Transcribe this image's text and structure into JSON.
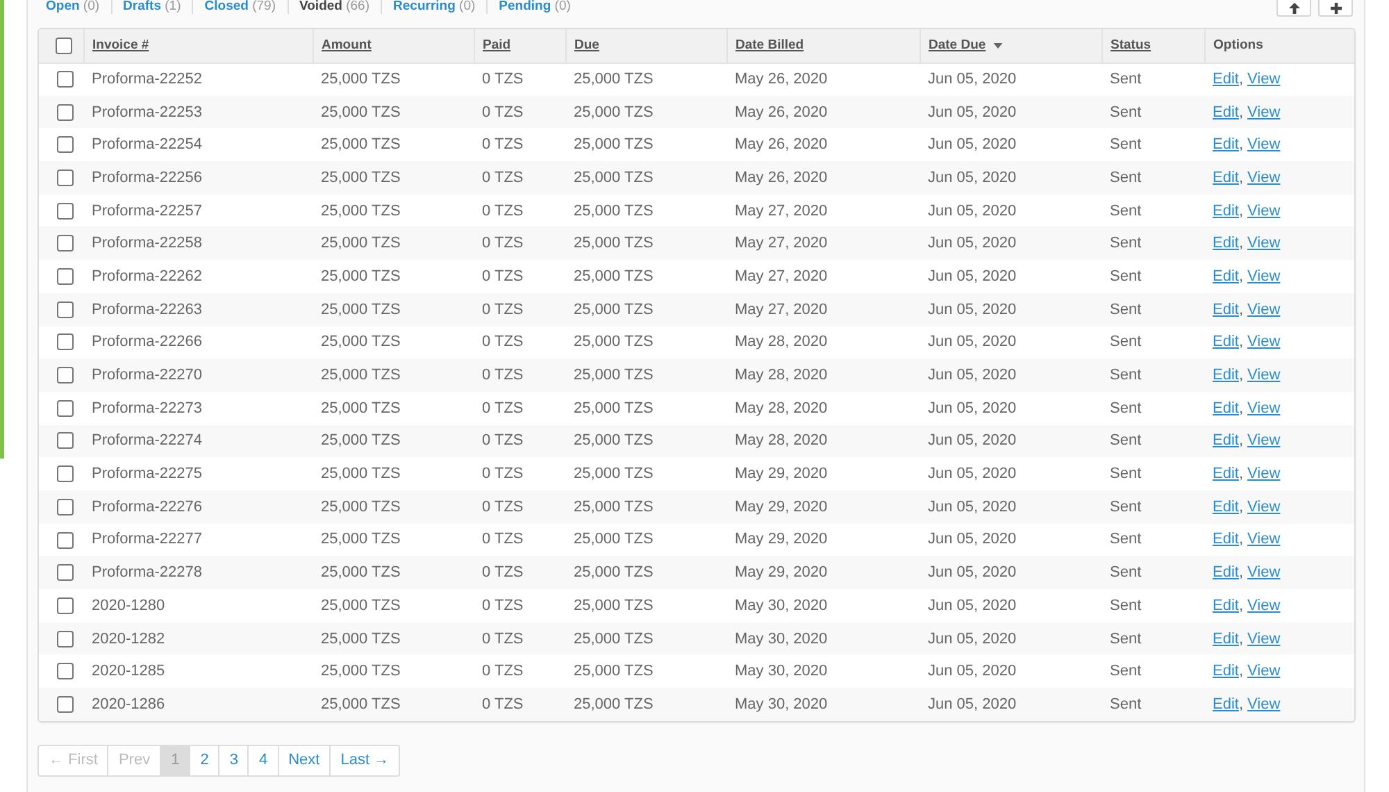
{
  "filters": [
    {
      "label": "Open",
      "count": "(0)",
      "selected": false
    },
    {
      "label": "Drafts",
      "count": "(1)",
      "selected": false
    },
    {
      "label": "Closed",
      "count": "(79)",
      "selected": false
    },
    {
      "label": "Voided",
      "count": "(66)",
      "selected": true
    },
    {
      "label": "Recurring",
      "count": "(0)",
      "selected": false
    },
    {
      "label": "Pending",
      "count": "(0)",
      "selected": false
    }
  ],
  "table": {
    "select_all": {
      "checked": false
    },
    "columns": [
      {
        "label": "Invoice #",
        "sortable": true,
        "sorted": false
      },
      {
        "label": "Amount",
        "sortable": true,
        "sorted": false
      },
      {
        "label": "Paid",
        "sortable": true,
        "sorted": false
      },
      {
        "label": "Due",
        "sortable": true,
        "sorted": false
      },
      {
        "label": "Date Billed",
        "sortable": true,
        "sorted": false
      },
      {
        "label": "Date Due",
        "sortable": true,
        "sorted": true
      },
      {
        "label": "Status",
        "sortable": true,
        "sorted": false
      },
      {
        "label": "Options",
        "sortable": false,
        "sorted": false
      }
    ],
    "options_separator": ",",
    "rows": [
      {
        "checked": false,
        "cells": [
          "Proforma-22252",
          "25,000 TZS",
          "0 TZS",
          "25,000 TZS",
          "May 26, 2020",
          "Jun 05, 2020",
          "Sent"
        ],
        "options": [
          "Edit",
          "View"
        ]
      },
      {
        "checked": false,
        "cells": [
          "Proforma-22253",
          "25,000 TZS",
          "0 TZS",
          "25,000 TZS",
          "May 26, 2020",
          "Jun 05, 2020",
          "Sent"
        ],
        "options": [
          "Edit",
          "View"
        ]
      },
      {
        "checked": false,
        "cells": [
          "Proforma-22254",
          "25,000 TZS",
          "0 TZS",
          "25,000 TZS",
          "May 26, 2020",
          "Jun 05, 2020",
          "Sent"
        ],
        "options": [
          "Edit",
          "View"
        ]
      },
      {
        "checked": false,
        "cells": [
          "Proforma-22256",
          "25,000 TZS",
          "0 TZS",
          "25,000 TZS",
          "May 26, 2020",
          "Jun 05, 2020",
          "Sent"
        ],
        "options": [
          "Edit",
          "View"
        ]
      },
      {
        "checked": false,
        "cells": [
          "Proforma-22257",
          "25,000 TZS",
          "0 TZS",
          "25,000 TZS",
          "May 27, 2020",
          "Jun 05, 2020",
          "Sent"
        ],
        "options": [
          "Edit",
          "View"
        ]
      },
      {
        "checked": false,
        "cells": [
          "Proforma-22258",
          "25,000 TZS",
          "0 TZS",
          "25,000 TZS",
          "May 27, 2020",
          "Jun 05, 2020",
          "Sent"
        ],
        "options": [
          "Edit",
          "View"
        ]
      },
      {
        "checked": false,
        "cells": [
          "Proforma-22262",
          "25,000 TZS",
          "0 TZS",
          "25,000 TZS",
          "May 27, 2020",
          "Jun 05, 2020",
          "Sent"
        ],
        "options": [
          "Edit",
          "View"
        ]
      },
      {
        "checked": false,
        "cells": [
          "Proforma-22263",
          "25,000 TZS",
          "0 TZS",
          "25,000 TZS",
          "May 27, 2020",
          "Jun 05, 2020",
          "Sent"
        ],
        "options": [
          "Edit",
          "View"
        ]
      },
      {
        "checked": false,
        "cells": [
          "Proforma-22266",
          "25,000 TZS",
          "0 TZS",
          "25,000 TZS",
          "May 28, 2020",
          "Jun 05, 2020",
          "Sent"
        ],
        "options": [
          "Edit",
          "View"
        ]
      },
      {
        "checked": false,
        "cells": [
          "Proforma-22270",
          "25,000 TZS",
          "0 TZS",
          "25,000 TZS",
          "May 28, 2020",
          "Jun 05, 2020",
          "Sent"
        ],
        "options": [
          "Edit",
          "View"
        ]
      },
      {
        "checked": false,
        "cells": [
          "Proforma-22273",
          "25,000 TZS",
          "0 TZS",
          "25,000 TZS",
          "May 28, 2020",
          "Jun 05, 2020",
          "Sent"
        ],
        "options": [
          "Edit",
          "View"
        ]
      },
      {
        "checked": false,
        "cells": [
          "Proforma-22274",
          "25,000 TZS",
          "0 TZS",
          "25,000 TZS",
          "May 28, 2020",
          "Jun 05, 2020",
          "Sent"
        ],
        "options": [
          "Edit",
          "View"
        ]
      },
      {
        "checked": false,
        "cells": [
          "Proforma-22275",
          "25,000 TZS",
          "0 TZS",
          "25,000 TZS",
          "May 29, 2020",
          "Jun 05, 2020",
          "Sent"
        ],
        "options": [
          "Edit",
          "View"
        ]
      },
      {
        "checked": false,
        "cells": [
          "Proforma-22276",
          "25,000 TZS",
          "0 TZS",
          "25,000 TZS",
          "May 29, 2020",
          "Jun 05, 2020",
          "Sent"
        ],
        "options": [
          "Edit",
          "View"
        ]
      },
      {
        "checked": false,
        "cells": [
          "Proforma-22277",
          "25,000 TZS",
          "0 TZS",
          "25,000 TZS",
          "May 29, 2020",
          "Jun 05, 2020",
          "Sent"
        ],
        "options": [
          "Edit",
          "View"
        ]
      },
      {
        "checked": false,
        "cells": [
          "Proforma-22278",
          "25,000 TZS",
          "0 TZS",
          "25,000 TZS",
          "May 29, 2020",
          "Jun 05, 2020",
          "Sent"
        ],
        "options": [
          "Edit",
          "View"
        ]
      },
      {
        "checked": false,
        "cells": [
          "2020-1280",
          "25,000 TZS",
          "0 TZS",
          "25,000 TZS",
          "May 30, 2020",
          "Jun 05, 2020",
          "Sent"
        ],
        "options": [
          "Edit",
          "View"
        ]
      },
      {
        "checked": false,
        "cells": [
          "2020-1282",
          "25,000 TZS",
          "0 TZS",
          "25,000 TZS",
          "May 30, 2020",
          "Jun 05, 2020",
          "Sent"
        ],
        "options": [
          "Edit",
          "View"
        ]
      },
      {
        "checked": false,
        "cells": [
          "2020-1285",
          "25,000 TZS",
          "0 TZS",
          "25,000 TZS",
          "May 30, 2020",
          "Jun 05, 2020",
          "Sent"
        ],
        "options": [
          "Edit",
          "View"
        ]
      },
      {
        "checked": false,
        "cells": [
          "2020-1286",
          "25,000 TZS",
          "0 TZS",
          "25,000 TZS",
          "May 30, 2020",
          "Jun 05, 2020",
          "Sent"
        ],
        "options": [
          "Edit",
          "View"
        ]
      }
    ]
  },
  "pagination": [
    {
      "label": "← First",
      "selected": false,
      "disabled": true
    },
    {
      "label": "Prev",
      "selected": false,
      "disabled": true
    },
    {
      "label": "1",
      "selected": true,
      "disabled": false
    },
    {
      "label": "2",
      "selected": false,
      "disabled": false
    },
    {
      "label": "3",
      "selected": false,
      "disabled": false
    },
    {
      "label": "4",
      "selected": false,
      "disabled": false
    },
    {
      "label": "Next",
      "selected": false,
      "disabled": false
    },
    {
      "label": "Last →",
      "selected": false,
      "disabled": false
    }
  ]
}
